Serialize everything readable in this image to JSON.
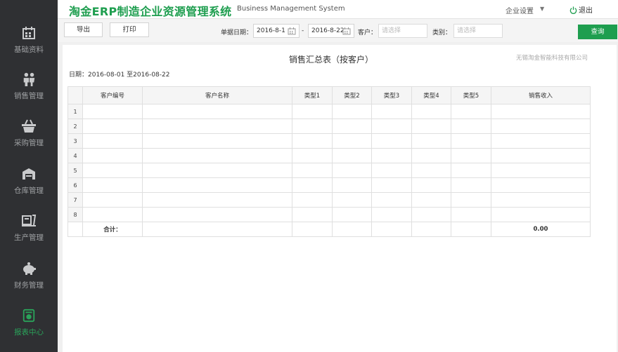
{
  "header": {
    "brand": "淘金ERP制造企业资源管理系统",
    "brand_en": "Business Management System",
    "settings_label": "企业设置",
    "logout_label": "退出"
  },
  "sidebar": {
    "items": [
      {
        "label": "基础资料",
        "icon": "calendar-icon"
      },
      {
        "label": "销售管理",
        "icon": "people-icon"
      },
      {
        "label": "采购管理",
        "icon": "basket-icon"
      },
      {
        "label": "仓库管理",
        "icon": "warehouse-icon"
      },
      {
        "label": "生产管理",
        "icon": "production-icon"
      },
      {
        "label": "财务管理",
        "icon": "piggy-bank-icon"
      },
      {
        "label": "报表中心",
        "icon": "report-icon",
        "active": true
      }
    ],
    "accent": "#2aa35a"
  },
  "toolbar": {
    "export_label": "导出",
    "print_label": "打印",
    "date_label": "单据日期：",
    "date_from": "2016-8-1",
    "date_sep": "-",
    "date_to": "2016-8-22",
    "customer_label": "客户：",
    "customer_placeholder": "请选择",
    "category_label": "类别：",
    "category_placeholder": "请选择",
    "query_label": "查询"
  },
  "report": {
    "title": "销售汇总表（按客户）",
    "company": "无锡淘金智能科技有限公司",
    "date_range": "日期：2016-08-01 至2016-08-22",
    "columns": [
      "",
      "客户编号",
      "客户名称",
      "类型1",
      "类型2",
      "类型3",
      "类型4",
      "类型5",
      "销售收入"
    ],
    "rows": [
      "1",
      "2",
      "3",
      "4",
      "5",
      "6",
      "7",
      "8"
    ],
    "total_label": "合计：",
    "total_income": "0.00"
  },
  "colors": {
    "brand_green": "#1e9e4f",
    "sidebar_bg": "#2f3033"
  }
}
